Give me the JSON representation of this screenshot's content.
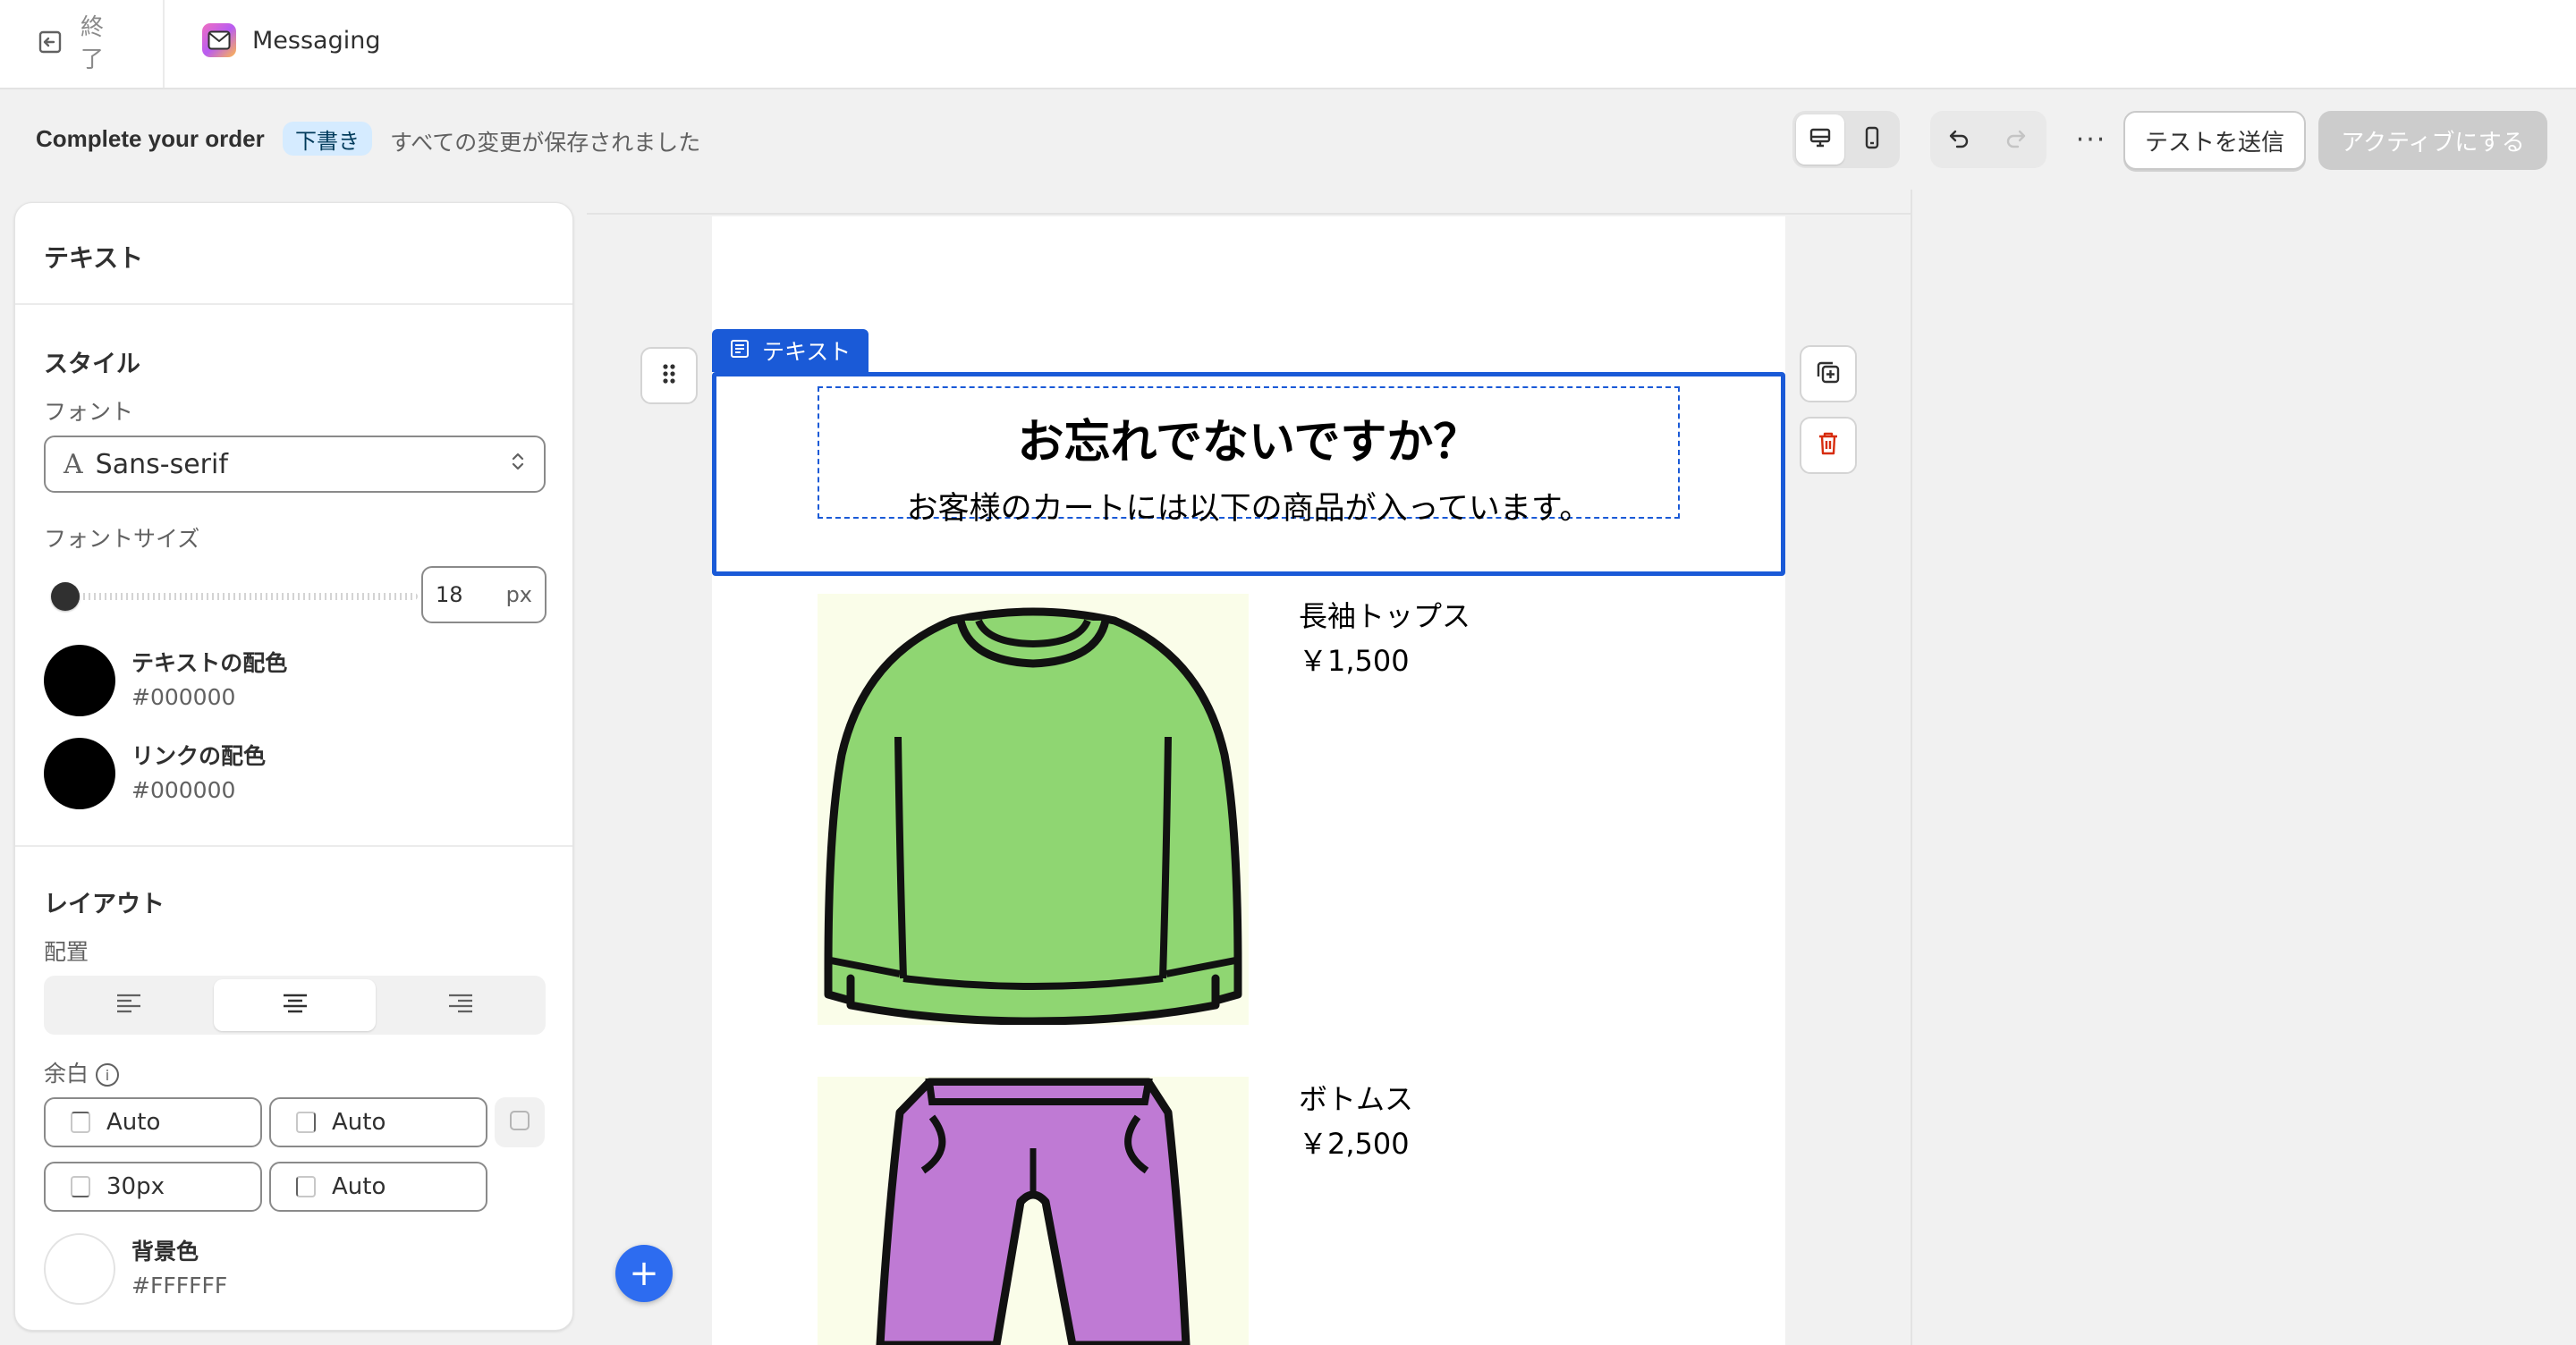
{
  "topbar": {
    "exit_label": "終了",
    "app_name": "Messaging"
  },
  "subbar": {
    "title": "Complete your order",
    "badge": "下書き",
    "status": "すべての変更が保存されました",
    "send_test": "テストを送信",
    "activate": "アクティブにする",
    "more": "···"
  },
  "panel": {
    "header": "テキスト",
    "style_section": "スタイル",
    "font_label": "フォント",
    "font_value": "Sans-serif",
    "font_size_label": "フォントサイズ",
    "font_size_value": "18",
    "font_size_unit": "px",
    "font_size_slider_fraction": 0.0,
    "text_color_name": "テキストの配色",
    "text_color_hex": "#000000",
    "link_color_name": "リンクの配色",
    "link_color_hex": "#000000",
    "layout_section": "レイアウト",
    "align_label": "配置",
    "align_selected": "center",
    "padding_label": "余白",
    "padding": [
      "Auto",
      "Auto",
      "30px",
      "Auto"
    ],
    "bg_color_name": "背景色",
    "bg_color_hex": "#FFFFFF"
  },
  "email": {
    "block_tag": "テキスト",
    "headline": "お忘れでないですか？",
    "subline": "お客様のカートには以下の商品が入っています。",
    "products": [
      {
        "name": "長袖トップス",
        "price": "￥1,500"
      },
      {
        "name": "ボトムス",
        "price": "￥2,500"
      }
    ]
  },
  "colors": {
    "accent": "#1a5ad7",
    "add_button": "#2d6cf0",
    "sweater": "#8fd672",
    "pants": "#bf7ad4",
    "badge_bg": "#d5ebff",
    "delete_red": "#d72c0d"
  }
}
